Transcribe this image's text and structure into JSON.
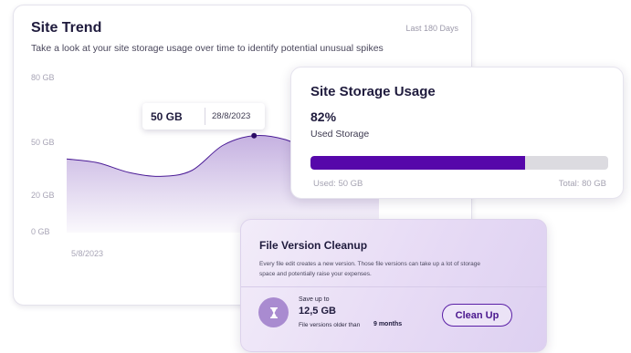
{
  "trend": {
    "title": "Site Trend",
    "range": "Last 180 Days",
    "subtitle": "Take a look at your site storage usage over time to identify potential unusual spikes",
    "tooltip": {
      "value": "50 GB",
      "date": "28/8/2023"
    }
  },
  "storage": {
    "title": "Site Storage Usage",
    "percent_label": "82%",
    "caption": "Used Storage",
    "used_fraction": 0.72,
    "used_label": "Used: 50 GB",
    "total_label": "Total: 80 GB"
  },
  "cleanup": {
    "title": "File Version Cleanup",
    "description": "Every file edit creates a new version. Those file versions can take up a lot of storage space and potentially raise your expenses.",
    "save_label": "Save up to",
    "save_value": "12,5 GB",
    "older_label": "File versions older than",
    "older_value": "9 months",
    "button_label": "Clean Up",
    "icon": "hourglass-icon"
  },
  "colors": {
    "accent": "#5607aa",
    "area_fill": "#c9b6e6",
    "track": "#dcdbe0"
  },
  "chart_data": {
    "type": "area",
    "title": "Site Trend",
    "ylim": [
      0,
      80
    ],
    "y_ticks": [
      "80 GB",
      "50 GB",
      "20 GB",
      "0 GB"
    ],
    "x_ticks": [
      "5/8/2023"
    ],
    "series": [
      {
        "values": [
          38,
          36,
          31,
          29,
          32,
          45,
          50,
          48,
          41,
          38,
          22
        ]
      }
    ],
    "highlight": {
      "index": 6,
      "value": 50,
      "label": "50 GB",
      "date": "28/8/2023"
    }
  }
}
